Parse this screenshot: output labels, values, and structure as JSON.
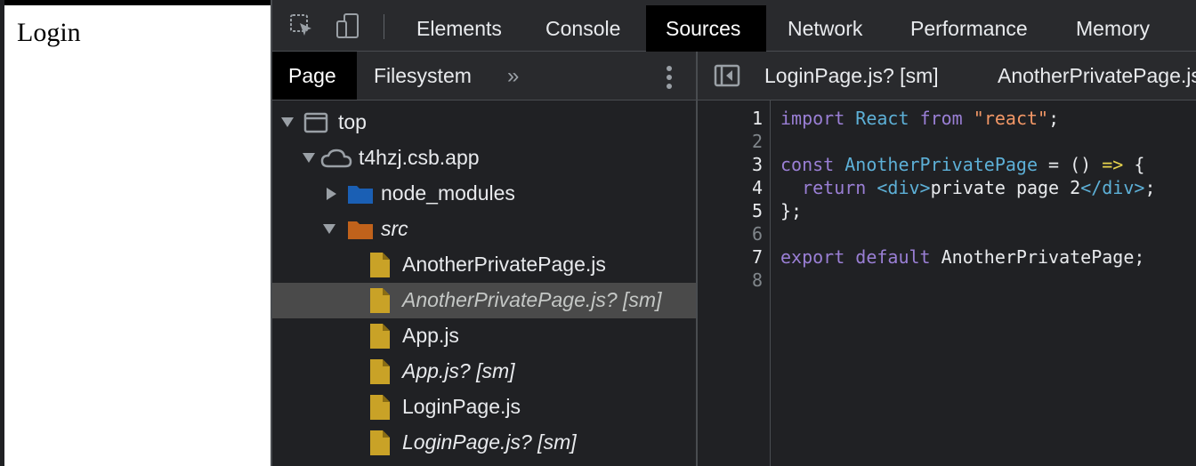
{
  "page": {
    "heading": "Login"
  },
  "devtools": {
    "tabs": [
      "Elements",
      "Console",
      "Sources",
      "Network",
      "Performance",
      "Memory"
    ],
    "active_tab": "Sources",
    "navigator": {
      "tabs": [
        "Page",
        "Filesystem"
      ],
      "more": "»",
      "tree": [
        {
          "label": "top",
          "icon": "frame-icon",
          "expanded": true
        },
        {
          "label": "t4hzj.csb.app",
          "icon": "cloud-icon",
          "expanded": true
        },
        {
          "label": "node_modules",
          "icon": "folder-icon",
          "expanded": false,
          "color": "#1a5fb4"
        },
        {
          "label": "src",
          "icon": "folder-icon",
          "expanded": true,
          "color": "#c0621b"
        },
        {
          "label": "AnotherPrivatePage.js",
          "icon": "file-icon"
        },
        {
          "label": "AnotherPrivatePage.js? [sm]",
          "icon": "file-icon",
          "selected": true
        },
        {
          "label": "App.js",
          "icon": "file-icon"
        },
        {
          "label": "App.js? [sm]",
          "icon": "file-icon"
        },
        {
          "label": "LoginPage.js",
          "icon": "file-icon"
        },
        {
          "label": "LoginPage.js? [sm]",
          "icon": "file-icon"
        }
      ]
    },
    "editor": {
      "tabs": [
        "LoginPage.js? [sm]",
        "AnotherPrivatePage.js"
      ],
      "line_numbers": [
        "1",
        "2",
        "3",
        "4",
        "5",
        "6",
        "7",
        "8"
      ],
      "code": {
        "l1": {
          "kw": "import",
          "ident": "React",
          "kw2": "from",
          "str": "\"react\"",
          "end": ";"
        },
        "l3": {
          "kw": "const",
          "ident": "AnotherPrivatePage",
          "mid": " = () ",
          "arrow": "=>",
          "end": " {"
        },
        "l4": {
          "indent": "  ",
          "kw": "return",
          "open": "<div>",
          "text": "private page 2",
          "close": "</div>",
          "end": ";"
        },
        "l5": {
          "text": "};"
        },
        "l7": {
          "kw1": "export",
          "kw2": "default",
          "text": "AnotherPrivatePage;"
        }
      }
    }
  }
}
